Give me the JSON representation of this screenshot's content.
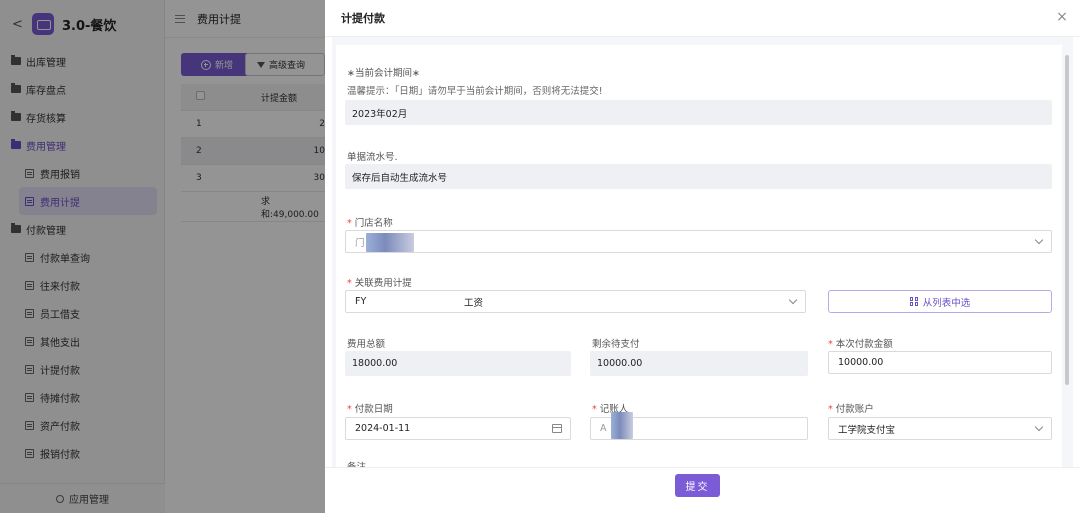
{
  "sidebar": {
    "back": "<",
    "title": "3.0-餐饮",
    "items": [
      {
        "label": "出库管理",
        "kind": "group"
      },
      {
        "label": "库存盘点",
        "kind": "group"
      },
      {
        "label": "存货核算",
        "kind": "group"
      },
      {
        "label": "费用管理",
        "kind": "group",
        "active": true
      },
      {
        "label": "费用报销",
        "kind": "sub"
      },
      {
        "label": "费用计提",
        "kind": "sub",
        "selected": true
      },
      {
        "label": "付款管理",
        "kind": "group"
      },
      {
        "label": "付款单查询",
        "kind": "sub"
      },
      {
        "label": "往来付款",
        "kind": "sub"
      },
      {
        "label": "员工借支",
        "kind": "sub"
      },
      {
        "label": "其他支出",
        "kind": "sub"
      },
      {
        "label": "计提付款",
        "kind": "sub"
      },
      {
        "label": "待摊付款",
        "kind": "sub"
      },
      {
        "label": "资产付款",
        "kind": "sub"
      },
      {
        "label": "报销付款",
        "kind": "sub"
      }
    ],
    "footer": "应用管理"
  },
  "main": {
    "title": "费用计提",
    "add_button": "新增",
    "advanced_button": "高级查询",
    "table": {
      "column": "计提金额",
      "rows": [
        {
          "index": "1",
          "amount": "2"
        },
        {
          "index": "2",
          "amount": "10"
        },
        {
          "index": "3",
          "amount": "30"
        }
      ],
      "summary": "求和:49,000.00"
    }
  },
  "drawer": {
    "title": "计提付款",
    "close": "×",
    "period": {
      "label": "∗当前会计期间∗",
      "hint": "温馨提示：「日期」请勿早于当前会计期间，否则将无法提交!",
      "value": "2023年02月"
    },
    "serial": {
      "label": "单据流水号.",
      "value": "保存后自动生成流水号"
    },
    "store": {
      "label": "门店名称",
      "value": "门"
    },
    "related": {
      "label": "关联费用计提",
      "value_prefix": "FY",
      "value_suffix": "工资",
      "button": "从列表中选"
    },
    "total": {
      "label": "费用总额",
      "value": "18000.00"
    },
    "remaining": {
      "label": "剩余待支付",
      "value": "10000.00"
    },
    "pay_amount": {
      "label": "本次付款金额",
      "value": "10000.00"
    },
    "pay_date": {
      "label": "付款日期",
      "value": "2024-01-11"
    },
    "bookkeeper": {
      "label": "记账人",
      "value": "A"
    },
    "account": {
      "label": "付款账户",
      "value": "工学院支付宝"
    },
    "remark_label": "备注",
    "submit": "提交"
  }
}
